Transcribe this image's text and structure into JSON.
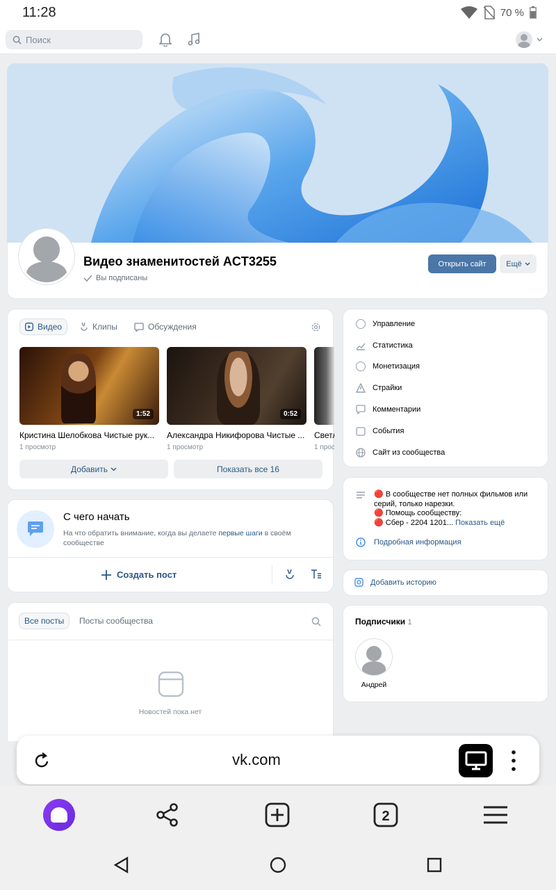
{
  "status": {
    "time": "11:28",
    "battery": "70 %"
  },
  "topbar": {
    "search_placeholder": "Поиск"
  },
  "community": {
    "name": "Видео знаменитостей ACT3255",
    "subscribed": "Вы подписаны",
    "open_site": "Открыть сайт",
    "more": "Ещё"
  },
  "media_tabs": {
    "video": "Видео",
    "clips": "Клипы",
    "discussions": "Обсуждения"
  },
  "videos": [
    {
      "title": "Кристина Шелобкова Чистые рук...",
      "meta": "1 просмотр",
      "duration": "1:52"
    },
    {
      "title": "Александра Никифорова Чистые ...",
      "meta": "1 просмотр",
      "duration": "0:52"
    },
    {
      "title": "Светл",
      "meta": "1 прос",
      "duration": ""
    }
  ],
  "video_actions": {
    "add": "Добавить",
    "show_all": "Показать все 16"
  },
  "start": {
    "title": "С чего начать",
    "desc_pre": "На что обратить внимание, когда вы делаете ",
    "desc_link": "первые шаги",
    "desc_post": " в своём сообществе",
    "create_post": "Создать пост"
  },
  "posts": {
    "all": "Все посты",
    "community": "Посты сообщества",
    "empty": "Новостей пока нет"
  },
  "admin_menu": [
    "Управление",
    "Статистика",
    "Монетизация",
    "Страйки",
    "Комментарии",
    "События",
    "Сайт из сообщества"
  ],
  "info": {
    "line1": "🔴 В сообществе нет полных фильмов или серий, только нарезки.",
    "line2": "🔴 Помощь сообществу:",
    "line3": "🔴 Сбер - 2204 1201...",
    "show_more": "Показать ещё",
    "details": "Подробная информация"
  },
  "story": {
    "add": "Добавить историю"
  },
  "subscribers": {
    "title": "Подписчики",
    "count": "1",
    "members": [
      {
        "name": "Андрей"
      }
    ]
  },
  "browser": {
    "url": "vk.com"
  }
}
